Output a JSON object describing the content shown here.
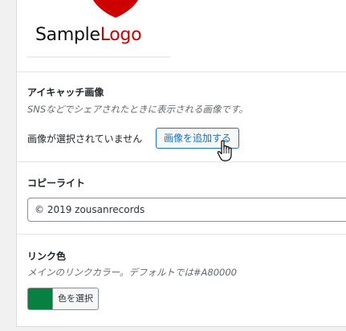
{
  "logo": {
    "text_part1": "Sample",
    "text_part2": "Logo",
    "accent_color": "#cc0000"
  },
  "eyecatch": {
    "title": "アイキャッチ画像",
    "description": "SNSなどでシェアされたときに表示される画像です。",
    "status": "画像が選択されていません",
    "add_button_label": "画像を追加する"
  },
  "copyright": {
    "title": "コピーライト",
    "value": "© 2019 zousanrecords"
  },
  "link_color": {
    "title": "リンク色",
    "description": "メインのリンクカラー。デフォルトでは#A80000",
    "swatch_color": "#078041",
    "button_label": "色を選択"
  },
  "icons": {
    "cursor": "hand-pointer-icon"
  }
}
